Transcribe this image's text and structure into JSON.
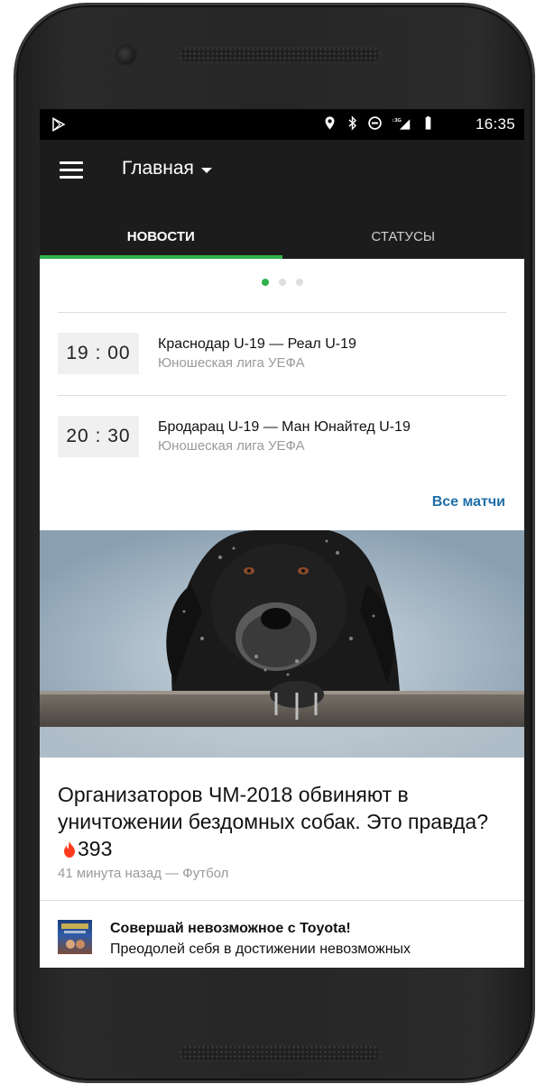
{
  "status_bar": {
    "time": "16:35",
    "network": "3G",
    "icons": [
      "play-store-icon",
      "location-icon",
      "bluetooth-icon",
      "dnd-icon",
      "signal-icon",
      "battery-icon"
    ]
  },
  "app_bar": {
    "title": "Главная",
    "menu_icon": "hamburger-menu-icon",
    "dropdown_icon": "caret-down-icon"
  },
  "tabs": [
    {
      "label": "НОВОСТИ",
      "active": true
    },
    {
      "label": "СТАТУСЫ",
      "active": false
    }
  ],
  "pager": {
    "count": 3,
    "active_index": 0
  },
  "matches": [
    {
      "time": "19 : 00",
      "teams": "Краснодар U-19 — Реал U-19",
      "league": "Юношеская лига УЕФА"
    },
    {
      "time": "20 : 30",
      "teams": "Бродарац U-19 — Ман Юнайтед U-19",
      "league": "Юношеская лига УЕФА"
    }
  ],
  "all_matches_label": "Все матчи",
  "news": {
    "title": "Организаторов ЧМ-2018 обвиняют в уничтожении бездомных собак. Это правда?",
    "comments": "393",
    "meta": "41 минута назад — Футбол"
  },
  "ad": {
    "title": "Совершай невозможное с Toyota!",
    "text": "Преодолей себя в достижении невозможных"
  },
  "colors": {
    "accent": "#2fb14b",
    "link": "#1f6fa8",
    "app_bar": "#1c1c1c",
    "fire": "#ff3b1f"
  }
}
